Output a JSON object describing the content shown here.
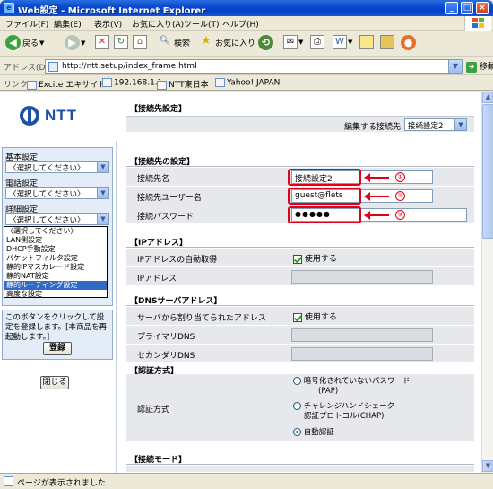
{
  "window": {
    "title": "Web設定 - Microsoft Internet Explorer",
    "min": "_",
    "max": "□",
    "close": "×"
  },
  "menu": [
    "ファイル(F)",
    "編集(E)",
    "表示(V)",
    "お気に入り(A)",
    "ツール(T)",
    "ヘルプ(H)"
  ],
  "toolbar": {
    "back": "戻る",
    "search": "検索",
    "favorites": "お気に入り"
  },
  "address": {
    "label": "アドレス(D)",
    "url": "http://ntt.setup/index_frame.html",
    "go": "移動"
  },
  "links": {
    "label": "リンク",
    "items": [
      "Excite エキサイト",
      "192.168.1.1",
      "NTT東日本",
      "Yahoo! JAPAN"
    ]
  },
  "logo": {
    "text": "NTT"
  },
  "left": {
    "basic_label": "基本設定",
    "basic_value": "〈選択してください〉",
    "phone_label": "電話設定",
    "phone_value": "〈選択してください〉",
    "detail_label": "詳細設定",
    "detail_value": "〈選択してください〉",
    "options": [
      "〈選択してください〉",
      "LAN側設定",
      "DHCP手動設定",
      "パケットフィルタ設定",
      "静的IPマスカレード設定",
      "静的NAT設定",
      "静的ルーティング設定",
      "高度な設定"
    ],
    "highlighted_option": "静的ルーティング設定",
    "note": "このボタンをクリックして設定を登録します。[本商品を再起動します。]",
    "register_button": "登録",
    "close_button": "閉じる"
  },
  "main": {
    "section_title": "【接続先設定】",
    "edit_label": "編集する接続先",
    "edit_value": "接続設定2",
    "conn_header": "【接続先の設定】",
    "conn_name_label": "接続先名",
    "conn_name_value": "接続設定2",
    "conn_user_label": "接続先ユーザー名",
    "conn_user_value": "guest@flets",
    "conn_pass_label": "接続パスワード",
    "conn_pass_value": "●●●●●",
    "marker1": "①",
    "marker2": "②",
    "marker3": "③",
    "ip_header": "【IPアドレス】",
    "ip_auto_label": "IPアドレスの自動取得",
    "ip_auto_check": "使用する",
    "ip_label": "IPアドレス",
    "dns_header": "【DNSサーバアドレス】",
    "dns_auto_label": "サーバから割り当てられたアドレス",
    "dns_auto_check": "使用する",
    "dns_primary_label": "プライマリDNS",
    "dns_secondary_label": "セカンダリDNS",
    "auth_header": "【認証方式】",
    "auth_label": "認証方式",
    "auth_opt1_line1": "暗号化されていないパスワード",
    "auth_opt1_line2": "(PAP)",
    "auth_opt2_line1": "チャレンジハンドシェーク",
    "auth_opt2_line2": "認証プロトコル(CHAP)",
    "auth_opt3": "自動認証",
    "mode_header": "【接続モード】"
  },
  "status": {
    "text": "ページが表示されました"
  }
}
